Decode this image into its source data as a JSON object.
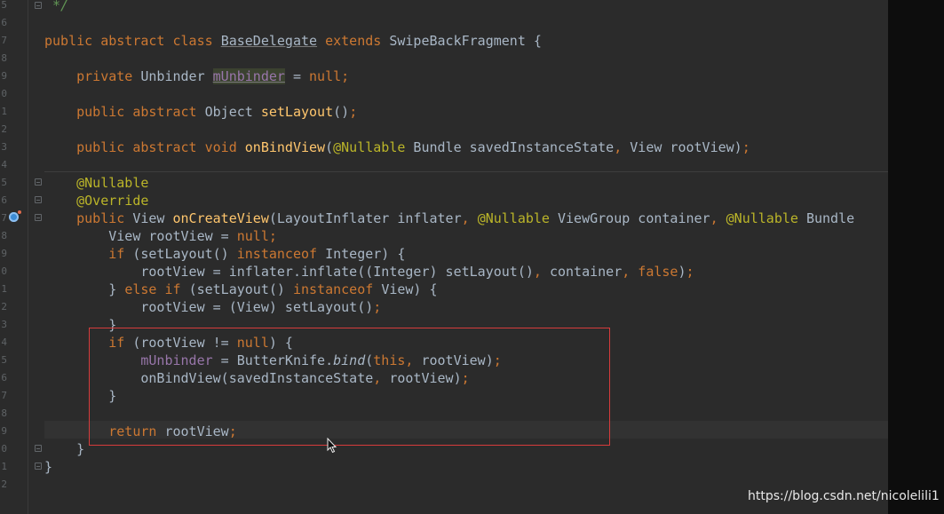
{
  "editor": {
    "line_numbers": [
      "5",
      "6",
      "7",
      "8",
      "9",
      "0",
      "1",
      "2",
      "3",
      "4",
      "5",
      "6",
      "7",
      "8",
      "9",
      "0",
      "1",
      "2",
      "3",
      "4",
      "5",
      "6",
      "7",
      "8",
      "9",
      "0",
      "1",
      "2"
    ],
    "lines": [
      [
        {
          "t": " */",
          "c": "cm"
        }
      ],
      [],
      [
        {
          "t": "public abstract class ",
          "c": "kw"
        },
        {
          "t": "BaseDelegate",
          "c": "ul"
        },
        {
          "t": " extends ",
          "c": "kw"
        },
        {
          "t": "SwipeBackFragment {",
          "c": ""
        }
      ],
      [],
      [
        {
          "t": "    private ",
          "c": "kw"
        },
        {
          "t": "Unbinder ",
          "c": ""
        },
        {
          "t": "mUnbinder",
          "c": "fd hl ul"
        },
        {
          "t": " = ",
          "c": ""
        },
        {
          "t": "null",
          "c": "kw"
        },
        {
          "t": ";",
          "c": "kw"
        }
      ],
      [],
      [
        {
          "t": "    public abstract ",
          "c": "kw"
        },
        {
          "t": "Object ",
          "c": ""
        },
        {
          "t": "setLayout",
          "c": "fn"
        },
        {
          "t": "()",
          "c": ""
        },
        {
          "t": ";",
          "c": "kw"
        }
      ],
      [],
      [
        {
          "t": "    public abstract void ",
          "c": "kw"
        },
        {
          "t": "onBindView",
          "c": "fn"
        },
        {
          "t": "(",
          "c": ""
        },
        {
          "t": "@Nullable",
          "c": "an"
        },
        {
          "t": " Bundle savedInstanceState",
          "c": ""
        },
        {
          "t": ", ",
          "c": "kw"
        },
        {
          "t": "View rootView)",
          "c": ""
        },
        {
          "t": ";",
          "c": "kw"
        }
      ],
      [],
      [
        {
          "t": "    @Nullable",
          "c": "an"
        }
      ],
      [
        {
          "t": "    @Override",
          "c": "an"
        }
      ],
      [
        {
          "t": "    public ",
          "c": "kw"
        },
        {
          "t": "View ",
          "c": ""
        },
        {
          "t": "onCreateView",
          "c": "fn"
        },
        {
          "t": "(LayoutInflater inflater",
          "c": ""
        },
        {
          "t": ", ",
          "c": "kw"
        },
        {
          "t": "@Nullable",
          "c": "an"
        },
        {
          "t": " ViewGroup container",
          "c": ""
        },
        {
          "t": ", ",
          "c": "kw"
        },
        {
          "t": "@Nullable",
          "c": "an"
        },
        {
          "t": " Bundle",
          "c": ""
        }
      ],
      [
        {
          "t": "        View rootView = ",
          "c": ""
        },
        {
          "t": "null",
          "c": "kw"
        },
        {
          "t": ";",
          "c": "kw"
        }
      ],
      [
        {
          "t": "        if ",
          "c": "kw"
        },
        {
          "t": "(setLayout() ",
          "c": ""
        },
        {
          "t": "instanceof ",
          "c": "kw"
        },
        {
          "t": "Integer) {",
          "c": ""
        }
      ],
      [
        {
          "t": "            rootView = inflater.inflate((Integer) setLayout()",
          "c": ""
        },
        {
          "t": ", ",
          "c": "kw"
        },
        {
          "t": "container",
          "c": ""
        },
        {
          "t": ", ",
          "c": "kw"
        },
        {
          "t": "false",
          "c": "kw"
        },
        {
          "t": ")",
          "c": ""
        },
        {
          "t": ";",
          "c": "kw"
        }
      ],
      [
        {
          "t": "        } ",
          "c": ""
        },
        {
          "t": "else if ",
          "c": "kw"
        },
        {
          "t": "(setLayout() ",
          "c": ""
        },
        {
          "t": "instanceof ",
          "c": "kw"
        },
        {
          "t": "View) {",
          "c": ""
        }
      ],
      [
        {
          "t": "            rootView = (View) setLayout()",
          "c": ""
        },
        {
          "t": ";",
          "c": "kw"
        }
      ],
      [
        {
          "t": "        }",
          "c": ""
        }
      ],
      [
        {
          "t": "        if ",
          "c": "kw"
        },
        {
          "t": "(rootView != ",
          "c": ""
        },
        {
          "t": "null",
          "c": "kw"
        },
        {
          "t": ") {",
          "c": ""
        }
      ],
      [
        {
          "t": "            mUnbinder",
          "c": "fd"
        },
        {
          "t": " = ButterKnife.",
          "c": ""
        },
        {
          "t": "bind",
          "c": "it"
        },
        {
          "t": "(",
          "c": ""
        },
        {
          "t": "this",
          "c": "kw"
        },
        {
          "t": ", ",
          "c": "kw"
        },
        {
          "t": "rootView)",
          "c": ""
        },
        {
          "t": ";",
          "c": "kw"
        }
      ],
      [
        {
          "t": "            onBindView(savedInstanceState",
          "c": ""
        },
        {
          "t": ", ",
          "c": "kw"
        },
        {
          "t": "rootView)",
          "c": ""
        },
        {
          "t": ";",
          "c": "kw"
        }
      ],
      [
        {
          "t": "        }",
          "c": ""
        }
      ],
      [],
      [
        {
          "t": "        return ",
          "c": "kw"
        },
        {
          "t": "rootView",
          "c": ""
        },
        {
          "t": ";",
          "c": "kw"
        }
      ],
      [
        {
          "t": "    }",
          "c": ""
        }
      ],
      [
        {
          "t": "}",
          "c": ""
        }
      ],
      []
    ]
  },
  "colors": {
    "background": "#2b2b2b",
    "keyword": "#cc7832",
    "annotation": "#bbb529",
    "method": "#ffc66d",
    "field": "#9876aa",
    "selection_border": "#d63c3c"
  },
  "watermark": "https://blog.csdn.net/nicolelili1"
}
